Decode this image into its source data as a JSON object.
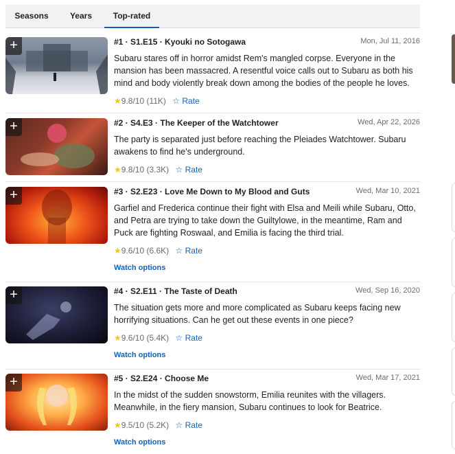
{
  "tabs": [
    {
      "label": "Seasons",
      "active": false
    },
    {
      "label": "Years",
      "active": false
    },
    {
      "label": "Top-rated",
      "active": true
    }
  ],
  "episodes": [
    {
      "title": "#1 · S1.E15 · Kyouki no Sotogawa",
      "date": "Mon, Jul 11, 2016",
      "description": "Subaru stares off in horror amidst Rem's mangled corpse. Everyone in the mansion has been massacred. A resentful voice calls out to Subaru as both his mind and body violently break down among the bodies of the people he loves.",
      "rating": "9.8",
      "rating_suffix": "/10 (11K)",
      "rate_label": "Rate",
      "watch_label": ""
    },
    {
      "title": "#2 · S4.E3 · The Keeper of the Watchtower",
      "date": "Wed, Apr 22, 2026",
      "description": "The party is separated just before reaching the Pleiades Watchtower. Subaru awakens to find he's underground.",
      "rating": "9.8",
      "rating_suffix": "/10 (3.3K)",
      "rate_label": "Rate",
      "watch_label": ""
    },
    {
      "title": "#3 · S2.E23 · Love Me Down to My Blood and Guts",
      "date": "Wed, Mar 10, 2021",
      "description": "Garfiel and Frederica continue their fight with Elsa and Meili while Subaru, Otto, and Petra are trying to take down the Guiltylowe, in the meantime, Ram and Puck are fighting Roswaal, and Emilia is facing the third trial.",
      "rating": "9.6",
      "rating_suffix": "/10 (6.6K)",
      "rate_label": "Rate",
      "watch_label": "Watch options"
    },
    {
      "title": "#4 · S2.E11 · The Taste of Death",
      "date": "Wed, Sep 16, 2020",
      "description": "The situation gets more and more complicated as Subaru keeps facing new horrifying situations. Can he get out these events in one piece?",
      "rating": "9.6",
      "rating_suffix": "/10 (5.4K)",
      "rate_label": "Rate",
      "watch_label": "Watch options"
    },
    {
      "title": "#5 · S2.E24 · Choose Me",
      "date": "Wed, Mar 17, 2021",
      "description": "In the midst of the sudden snowstorm, Emilia reunites with the villagers. Meanwhile, in the fiery mansion, Subaru continues to look for Beatrice.",
      "rating": "9.5",
      "rating_suffix": "/10 (5.2K)",
      "rate_label": "Rate",
      "watch_label": "Watch options"
    }
  ],
  "icons": {
    "add": "plus-icon",
    "filled_star": "star-icon",
    "outline_star": "star-outline-icon"
  },
  "colors": {
    "accent": "#0e63be",
    "star": "#f5c518"
  }
}
